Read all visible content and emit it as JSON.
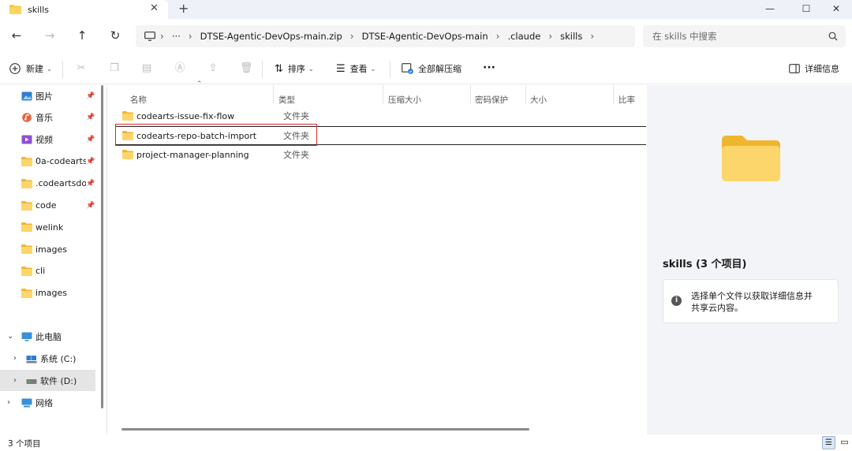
{
  "window": {
    "tab_title": "skills",
    "tab_close": "✕",
    "new_tab": "+",
    "minimize": "—",
    "maximize": "☐",
    "close": "✕"
  },
  "address": {
    "breadcrumb": [
      "DTSE-Agentic-DevOps-main.zip",
      "DTSE-Agentic-DevOps-main",
      ".claude",
      "skills"
    ],
    "more": "···",
    "search_placeholder": "在 skills 中搜索"
  },
  "toolbar": {
    "new_label": "新建",
    "sort_label": "排序",
    "view_label": "查看",
    "extract_label": "全部解压缩",
    "more": "···",
    "details_label": "详细信息"
  },
  "sidebar": {
    "quick": [
      {
        "label": "图片",
        "icon": "pictures-icon",
        "pinned": true
      },
      {
        "label": "音乐",
        "icon": "music-icon",
        "pinned": true
      },
      {
        "label": "视频",
        "icon": "videos-icon",
        "pinned": true
      },
      {
        "label": "0a-codearts",
        "icon": "folder-icon",
        "pinned": true
      },
      {
        "label": ".codeartsdo",
        "icon": "folder-icon",
        "pinned": true
      },
      {
        "label": "code",
        "icon": "folder-icon",
        "pinned": true
      },
      {
        "label": "welink",
        "icon": "folder-icon",
        "pinned": false
      },
      {
        "label": "images",
        "icon": "folder-icon",
        "pinned": false
      },
      {
        "label": "cli",
        "icon": "folder-icon",
        "pinned": false
      },
      {
        "label": "images",
        "icon": "folder-icon",
        "pinned": false
      }
    ],
    "this_pc": "此电脑",
    "drive_c": "系统 (C:)",
    "drive_d": "软件 (D:)",
    "network": "网络"
  },
  "columns": {
    "name": "名称",
    "type": "类型",
    "compressed_size": "压缩大小",
    "password": "密码保护",
    "size": "大小",
    "ratio": "比率"
  },
  "files": [
    {
      "name": "codearts-issue-fix-flow",
      "type": "文件夹"
    },
    {
      "name": "codearts-repo-batch-import",
      "type": "文件夹"
    },
    {
      "name": "project-manager-planning",
      "type": "文件夹"
    }
  ],
  "details": {
    "title": "skills (3 个项目)",
    "info_line1": "选择单个文件以获取详细信息并",
    "info_line2": "共享云内容。",
    "info_glyph": "i"
  },
  "status": {
    "count": "3 个项目"
  },
  "colors": {
    "folder": "#f7c948",
    "highlight_border": "#d9292b",
    "selected_bg": "#e5e5e5"
  }
}
